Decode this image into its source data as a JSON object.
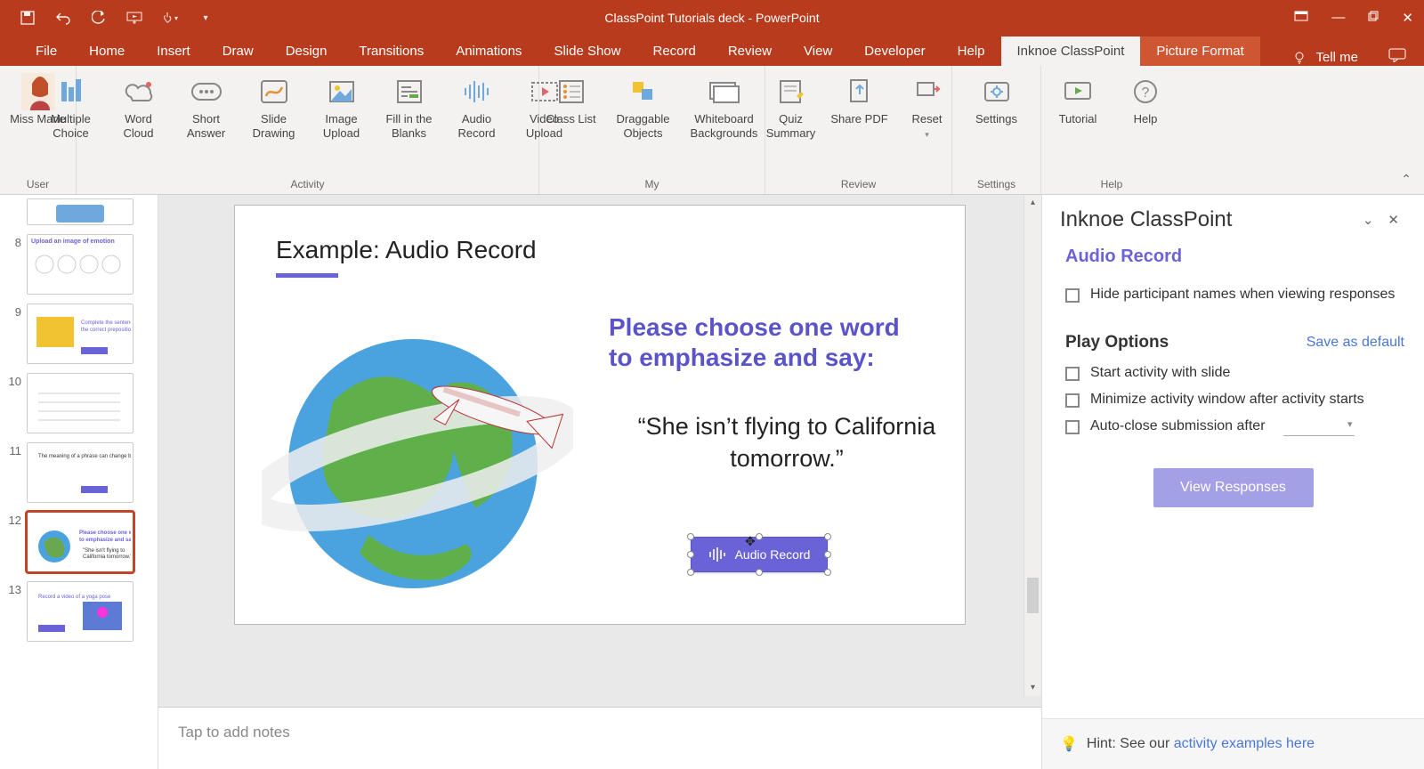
{
  "title": "ClassPoint Tutorials deck  -  PowerPoint",
  "tabs": [
    "File",
    "Home",
    "Insert",
    "Draw",
    "Design",
    "Transitions",
    "Animations",
    "Slide Show",
    "Record",
    "Review",
    "View",
    "Developer",
    "Help",
    "Inknoe ClassPoint",
    "Picture Format"
  ],
  "tell_me": "Tell me",
  "ribbon": {
    "user_name": "Miss Marie",
    "items": {
      "multiple_choice": "Multiple Choice",
      "word_cloud": "Word Cloud",
      "short_answer": "Short Answer",
      "slide_drawing": "Slide Drawing",
      "image_upload": "Image Upload",
      "fill_blanks": "Fill in the Blanks",
      "audio_record": "Audio Record",
      "video_upload": "Video Upload",
      "class_list": "Class List",
      "draggable": "Draggable Objects",
      "whiteboard": "Whiteboard Backgrounds",
      "quiz_summary": "Quiz Summary",
      "share_pdf": "Share PDF",
      "reset": "Reset",
      "settings": "Settings",
      "tutorial": "Tutorial",
      "help": "Help"
    },
    "groups": {
      "user": "User",
      "activity": "Activity",
      "my": "My",
      "review": "Review",
      "settings": "Settings",
      "help": "Help"
    }
  },
  "thumbs": [
    {
      "n": ""
    },
    {
      "n": "8"
    },
    {
      "n": "9"
    },
    {
      "n": "10"
    },
    {
      "n": "11"
    },
    {
      "n": "12",
      "selected": true
    },
    {
      "n": "13"
    }
  ],
  "slide": {
    "title": "Example: Audio Record",
    "prompt": "Please choose one word to emphasize and say:",
    "quote": "“She isn’t flying to California tomorrow.”",
    "button": "Audio Record"
  },
  "notes_placeholder": "Tap to add notes",
  "pane": {
    "title": "Inknoe ClassPoint",
    "subtitle": "Audio Record",
    "hide_names": "Hide participant names when viewing responses",
    "play_options": "Play Options",
    "save_default": "Save as default",
    "opt_start": "Start activity with slide",
    "opt_minimize": "Minimize activity window after activity starts",
    "opt_autoclose": "Auto-close submission after",
    "view_responses": "View Responses",
    "hint_prefix": "Hint: See our ",
    "hint_link": "activity examples here"
  }
}
